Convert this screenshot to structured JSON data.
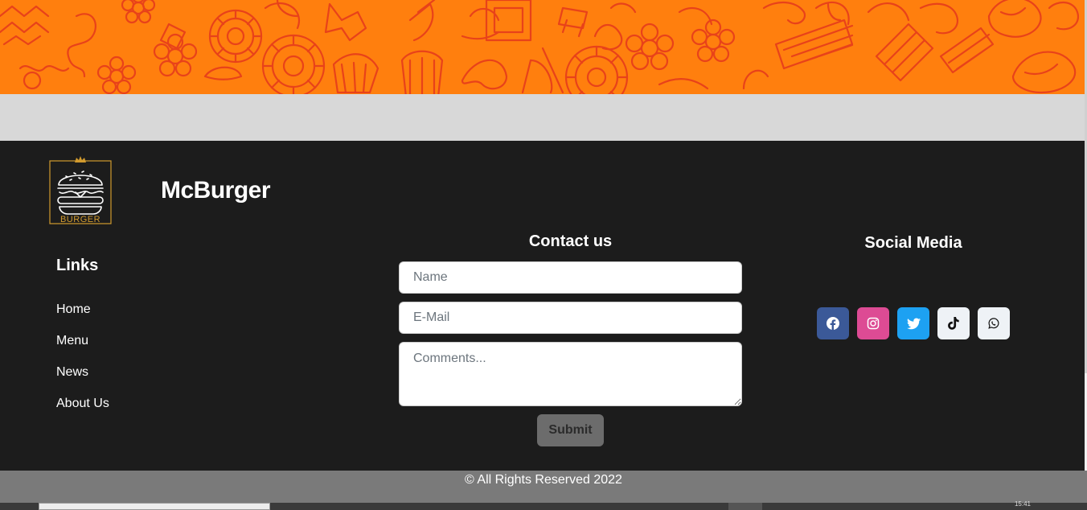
{
  "brand": {
    "name": "McBurger",
    "logo_text": "BURGER",
    "logo_icon": "burger-crown-icon",
    "accent_color": "#d19a2e"
  },
  "banner": {
    "color": "#ff7f0e",
    "pattern_color": "#e8421a",
    "pattern": "food-doodle-pattern"
  },
  "links": {
    "title": "Links",
    "items": [
      {
        "label": "Home"
      },
      {
        "label": "Menu"
      },
      {
        "label": "News"
      },
      {
        "label": "About Us"
      }
    ]
  },
  "contact": {
    "title": "Contact us",
    "name_placeholder": "Name",
    "email_placeholder": "E-Mail",
    "comments_placeholder": "Comments...",
    "submit_label": "Submit"
  },
  "social": {
    "title": "Social Media",
    "buttons": [
      {
        "icon": "facebook-icon",
        "color": "#3b5998"
      },
      {
        "icon": "instagram-icon",
        "color": "#dd4b94"
      },
      {
        "icon": "twitter-icon",
        "color": "#1da1f2"
      },
      {
        "icon": "tiktok-icon",
        "color": "#eef2f6"
      },
      {
        "icon": "whatsapp-icon",
        "color": "#eef2f6"
      }
    ]
  },
  "footer": {
    "copyright": "© All Rights Reserved 2022"
  },
  "taskbar": {
    "clock": "15:41"
  }
}
